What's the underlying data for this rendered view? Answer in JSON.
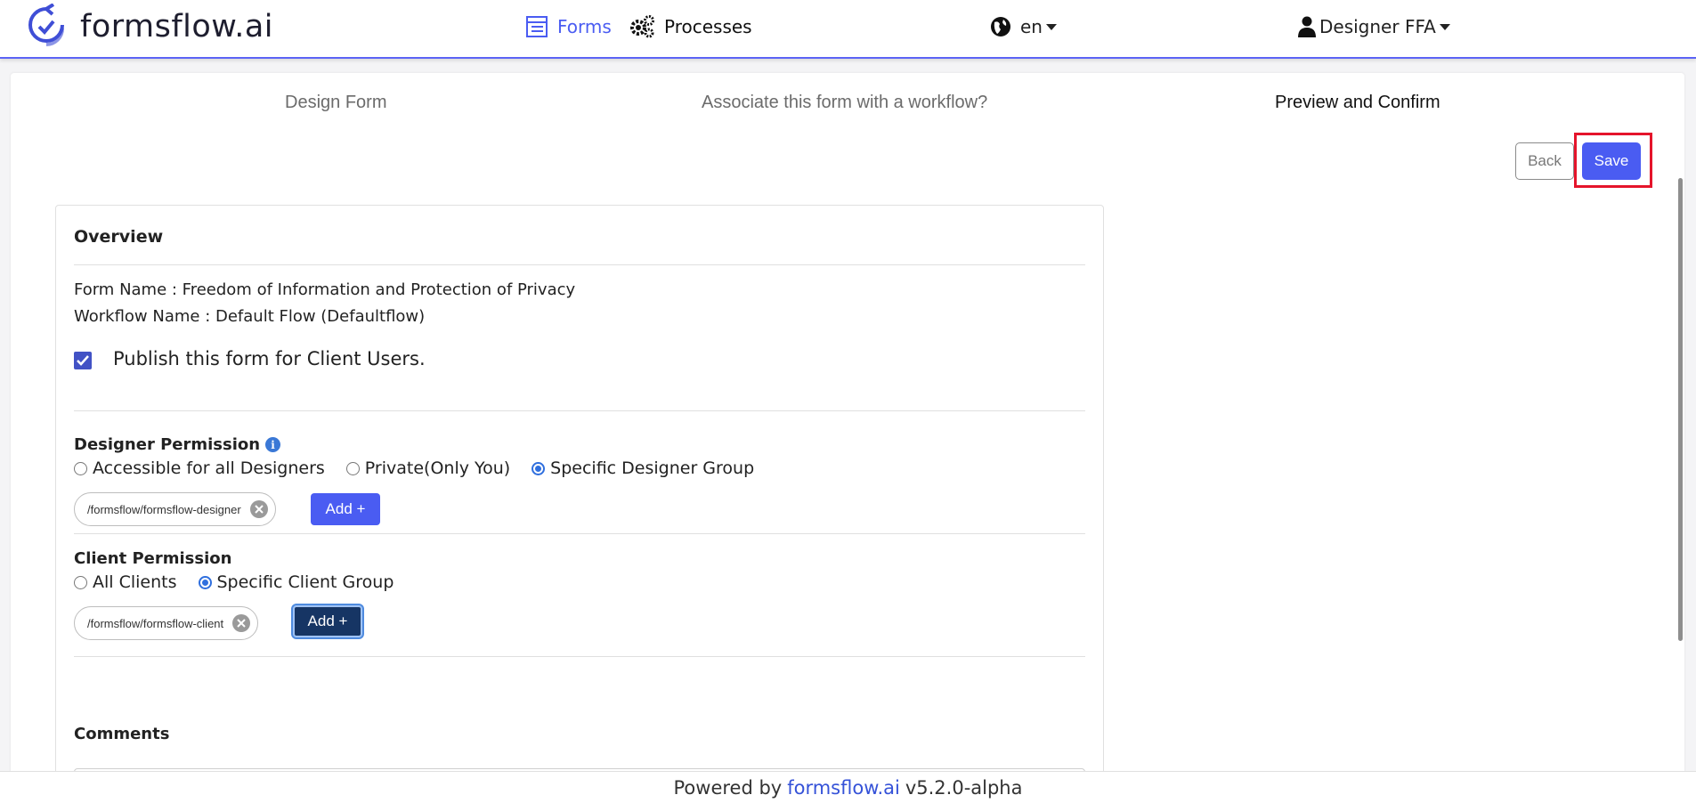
{
  "nav": {
    "brand": "formsflow.ai",
    "forms": "Forms",
    "processes": "Processes",
    "language": "en",
    "user": "Designer FFA"
  },
  "steps": [
    "Design Form",
    "Associate this form with a workflow?",
    "Preview and Confirm"
  ],
  "actions": {
    "back": "Back",
    "save": "Save"
  },
  "overview": {
    "title": "Overview",
    "form_name": "Form Name : Freedom of Information and Protection of Privacy",
    "workflow_name": "Workflow Name : Default Flow (Defaultflow)",
    "publish_label": "Publish this form for Client Users.",
    "publish_checked": true
  },
  "designer_permission": {
    "title": "Designer Permission",
    "options": [
      "Accessible for all Designers",
      "Private(Only You)",
      "Specific Designer Group"
    ],
    "selected": "Specific Designer Group",
    "chip": "/formsflow/formsflow-designer",
    "add_label": "Add +"
  },
  "client_permission": {
    "title": "Client Permission",
    "options": [
      "All Clients",
      "Specific Client Group"
    ],
    "selected": "Specific Client Group",
    "chip": "/formsflow/formsflow-client",
    "add_label": "Add +"
  },
  "comments": {
    "title": "Comments"
  },
  "footer": {
    "prefix": "Powered by",
    "link": "formsflow.ai",
    "version": "v5.2.0-alpha"
  },
  "colors": {
    "accent": "#4a5cf2",
    "highlight": "#e5142b",
    "focused_button": "#163564"
  }
}
